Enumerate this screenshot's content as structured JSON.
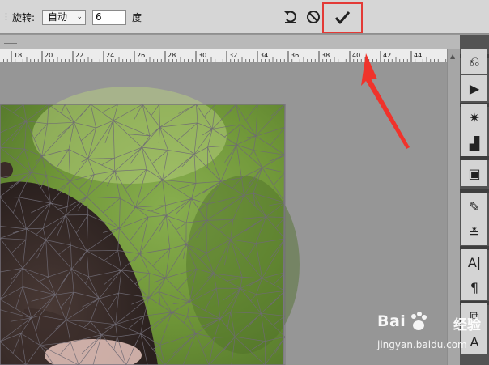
{
  "options_bar": {
    "grip_glyph": "⋮",
    "rotate_label": "旋转:",
    "rotate_mode_value": "自动",
    "dropdown_arrow": "⌄",
    "angle_value": "6",
    "angle_unit": "度"
  },
  "ruler": {
    "ticks": [
      "18",
      "20",
      "22",
      "24",
      "26",
      "28",
      "30",
      "32",
      "34",
      "36",
      "38",
      "40",
      "42",
      "44"
    ]
  },
  "dock": {
    "tools": [
      {
        "name": "history-tool-icon",
        "glyph": "⎌"
      },
      {
        "name": "actions-play-icon",
        "glyph": "▶"
      },
      {
        "name": "navigator-wheel-icon",
        "glyph": "✷"
      },
      {
        "name": "histogram-icon",
        "glyph": "▟"
      },
      {
        "name": "3d-cube-icon",
        "glyph": "▣"
      },
      {
        "name": "brush-presets-icon",
        "glyph": "✎"
      },
      {
        "name": "brush-settings-icon",
        "glyph": "≛"
      },
      {
        "name": "character-panel-icon",
        "glyph": "A|"
      },
      {
        "name": "paragraph-panel-icon",
        "glyph": "¶"
      },
      {
        "name": "character-styles-icon",
        "glyph": "⧉"
      },
      {
        "name": "paragraph-styles-icon",
        "glyph": "A"
      }
    ]
  },
  "watermark": {
    "brand_text": "Bai",
    "cn_text": "经验",
    "url_text": "jingyan.baidu.com"
  },
  "colors": {
    "accent_red": "#e33a36",
    "panel_bg": "#535353",
    "toolbar_bg": "#d6d6d6"
  }
}
